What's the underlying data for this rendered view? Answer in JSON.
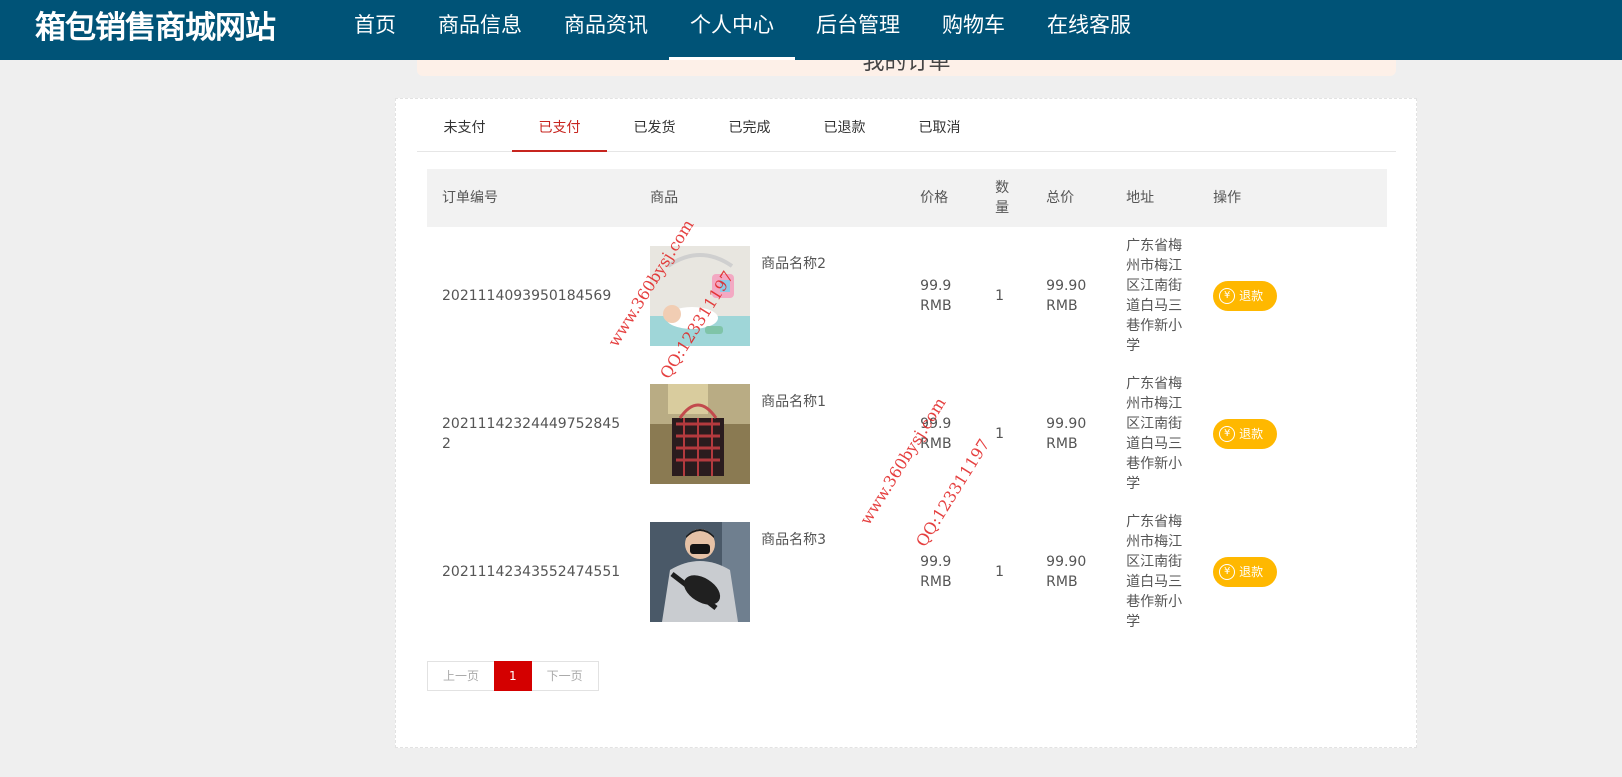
{
  "site": {
    "title": "箱包销售商城网站"
  },
  "nav": {
    "items": [
      {
        "label": "首页"
      },
      {
        "label": "商品信息"
      },
      {
        "label": "商品资讯"
      },
      {
        "label": "个人中心"
      },
      {
        "label": "后台管理"
      },
      {
        "label": "购物车"
      },
      {
        "label": "在线客服"
      }
    ],
    "active": "个人中心"
  },
  "banner": {
    "title": "我的订单"
  },
  "tabs": {
    "items": [
      {
        "label": "未支付"
      },
      {
        "label": "已支付"
      },
      {
        "label": "已发货"
      },
      {
        "label": "已完成"
      },
      {
        "label": "已退款"
      },
      {
        "label": "已取消"
      }
    ],
    "active": "已支付"
  },
  "table": {
    "headers": {
      "order_no": "订单编号",
      "goods": "商品",
      "price": "价格",
      "qty": "数量",
      "total": "总价",
      "address": "地址",
      "action": "操作"
    },
    "rows": [
      {
        "order_no": "2021114093950184569",
        "goods_name": "商品名称2",
        "price": "99.9 RMB",
        "qty": "1",
        "total": "99.90 RMB",
        "address": "广东省梅州市梅江区江南街道白马三巷作新小学",
        "action": "退款"
      },
      {
        "order_no": "20211142324449752845​2",
        "goods_name": "商品名称1",
        "price": "99.9 RMB",
        "qty": "1",
        "total": "99.90 RMB",
        "address": "广东省梅州市梅江区江南街道白马三巷作新小学",
        "action": "退款"
      },
      {
        "order_no": "20211142343552474551",
        "goods_name": "商品名称3",
        "price": "99.9 RMB",
        "qty": "1",
        "total": "99.90 RMB",
        "address": "广东省梅州市梅江区江南街道白马三巷作新小学",
        "action": "退款"
      }
    ]
  },
  "pager": {
    "prev": "上一页",
    "current": "1",
    "next": "下一页"
  },
  "watermark": {
    "site": "www.360bysj.com",
    "qq": "QQ:123311197"
  },
  "colors": {
    "header": "#005377",
    "accent": "#c7251f",
    "refund": "#ffb800",
    "page_current": "#d40000"
  }
}
